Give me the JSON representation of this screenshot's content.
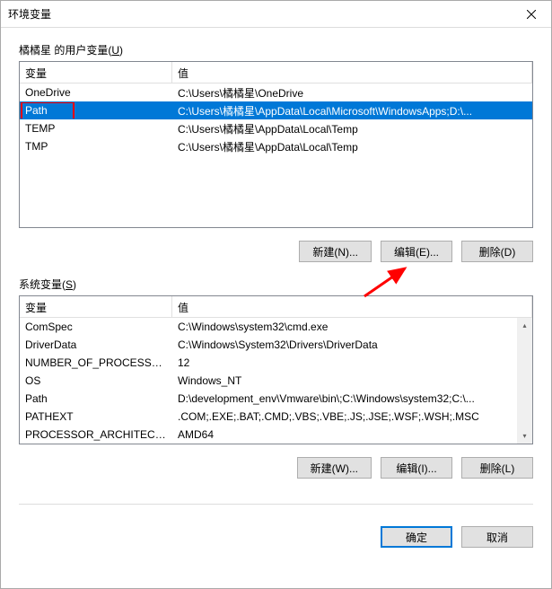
{
  "title": "环境变量",
  "user_section": {
    "label_prefix": "橘橘星 的用户变量(",
    "label_key": "U",
    "label_suffix": ")",
    "columns": {
      "name": "变量",
      "value": "值"
    },
    "rows": [
      {
        "name": "OneDrive",
        "value": "C:\\Users\\橘橘星\\OneDrive"
      },
      {
        "name": "Path",
        "value": "C:\\Users\\橘橘星\\AppData\\Local\\Microsoft\\WindowsApps;D:\\..."
      },
      {
        "name": "TEMP",
        "value": "C:\\Users\\橘橘星\\AppData\\Local\\Temp"
      },
      {
        "name": "TMP",
        "value": "C:\\Users\\橘橘星\\AppData\\Local\\Temp"
      }
    ],
    "selected_index": 1,
    "buttons": {
      "new": "新建(N)...",
      "edit": "编辑(E)...",
      "delete": "删除(D)"
    }
  },
  "system_section": {
    "label_prefix": "系统变量(",
    "label_key": "S",
    "label_suffix": ")",
    "columns": {
      "name": "变量",
      "value": "值"
    },
    "rows": [
      {
        "name": "ComSpec",
        "value": "C:\\Windows\\system32\\cmd.exe"
      },
      {
        "name": "DriverData",
        "value": "C:\\Windows\\System32\\Drivers\\DriverData"
      },
      {
        "name": "NUMBER_OF_PROCESSORS",
        "value": "12"
      },
      {
        "name": "OS",
        "value": "Windows_NT"
      },
      {
        "name": "Path",
        "value": "D:\\development_env\\Vmware\\bin\\;C:\\Windows\\system32;C:\\..."
      },
      {
        "name": "PATHEXT",
        "value": ".COM;.EXE;.BAT;.CMD;.VBS;.VBE;.JS;.JSE;.WSF;.WSH;.MSC"
      },
      {
        "name": "PROCESSOR_ARCHITECT...",
        "value": "AMD64"
      }
    ],
    "buttons": {
      "new": "新建(W)...",
      "edit": "编辑(I)...",
      "delete": "删除(L)"
    }
  },
  "dialog_buttons": {
    "ok": "确定",
    "cancel": "取消"
  }
}
